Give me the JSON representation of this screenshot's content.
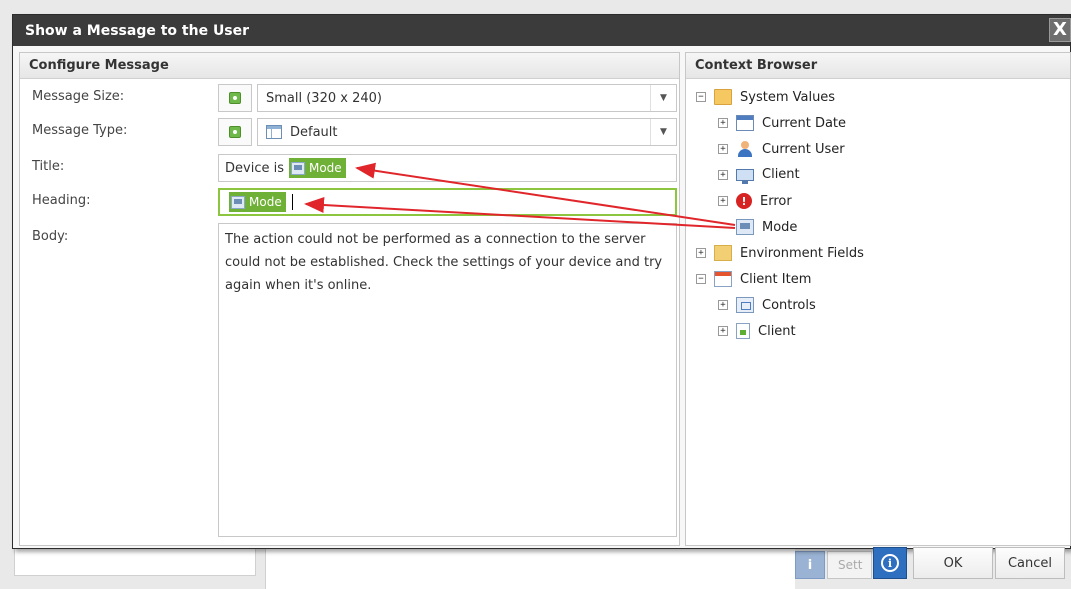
{
  "dialog": {
    "title": "Show a Message to the User",
    "close_label": "X"
  },
  "configure": {
    "header": "Configure Message",
    "message_size_label": "Message Size:",
    "message_size_value": "Small (320 x 240)",
    "message_type_label": "Message Type:",
    "message_type_value": "Default",
    "title_label": "Title:",
    "title_prefix": "Device is",
    "title_token": "Mode",
    "heading_label": "Heading:",
    "heading_token": "Mode",
    "body_label": "Body:",
    "body_text": "The action could not be performed as a connection to the server could not be established. Check the settings of your device and try again when it's online."
  },
  "context": {
    "header": "Context Browser",
    "nodes": [
      {
        "label": "System Values",
        "expander": "−"
      },
      {
        "label": "Current Date",
        "expander": "+"
      },
      {
        "label": "Current User",
        "expander": "+"
      },
      {
        "label": "Client",
        "expander": "+"
      },
      {
        "label": "Error",
        "expander": "+"
      },
      {
        "label": "Mode",
        "expander": ""
      },
      {
        "label": "Environment Fields",
        "expander": "+"
      },
      {
        "label": "Client Item",
        "expander": "−"
      },
      {
        "label": "Controls",
        "expander": "+"
      },
      {
        "label": "Client",
        "expander": "+"
      }
    ]
  },
  "footer": {
    "info_label": "i",
    "ok_label": "OK",
    "cancel_label": "Cancel"
  },
  "background": {
    "info_label": "i",
    "settings_label": "Sett"
  },
  "colors": {
    "token_green": "#6fb036",
    "active_border": "#8cc63f",
    "arrow_red": "#e0262a",
    "titlebar": "#3b3b3b"
  }
}
